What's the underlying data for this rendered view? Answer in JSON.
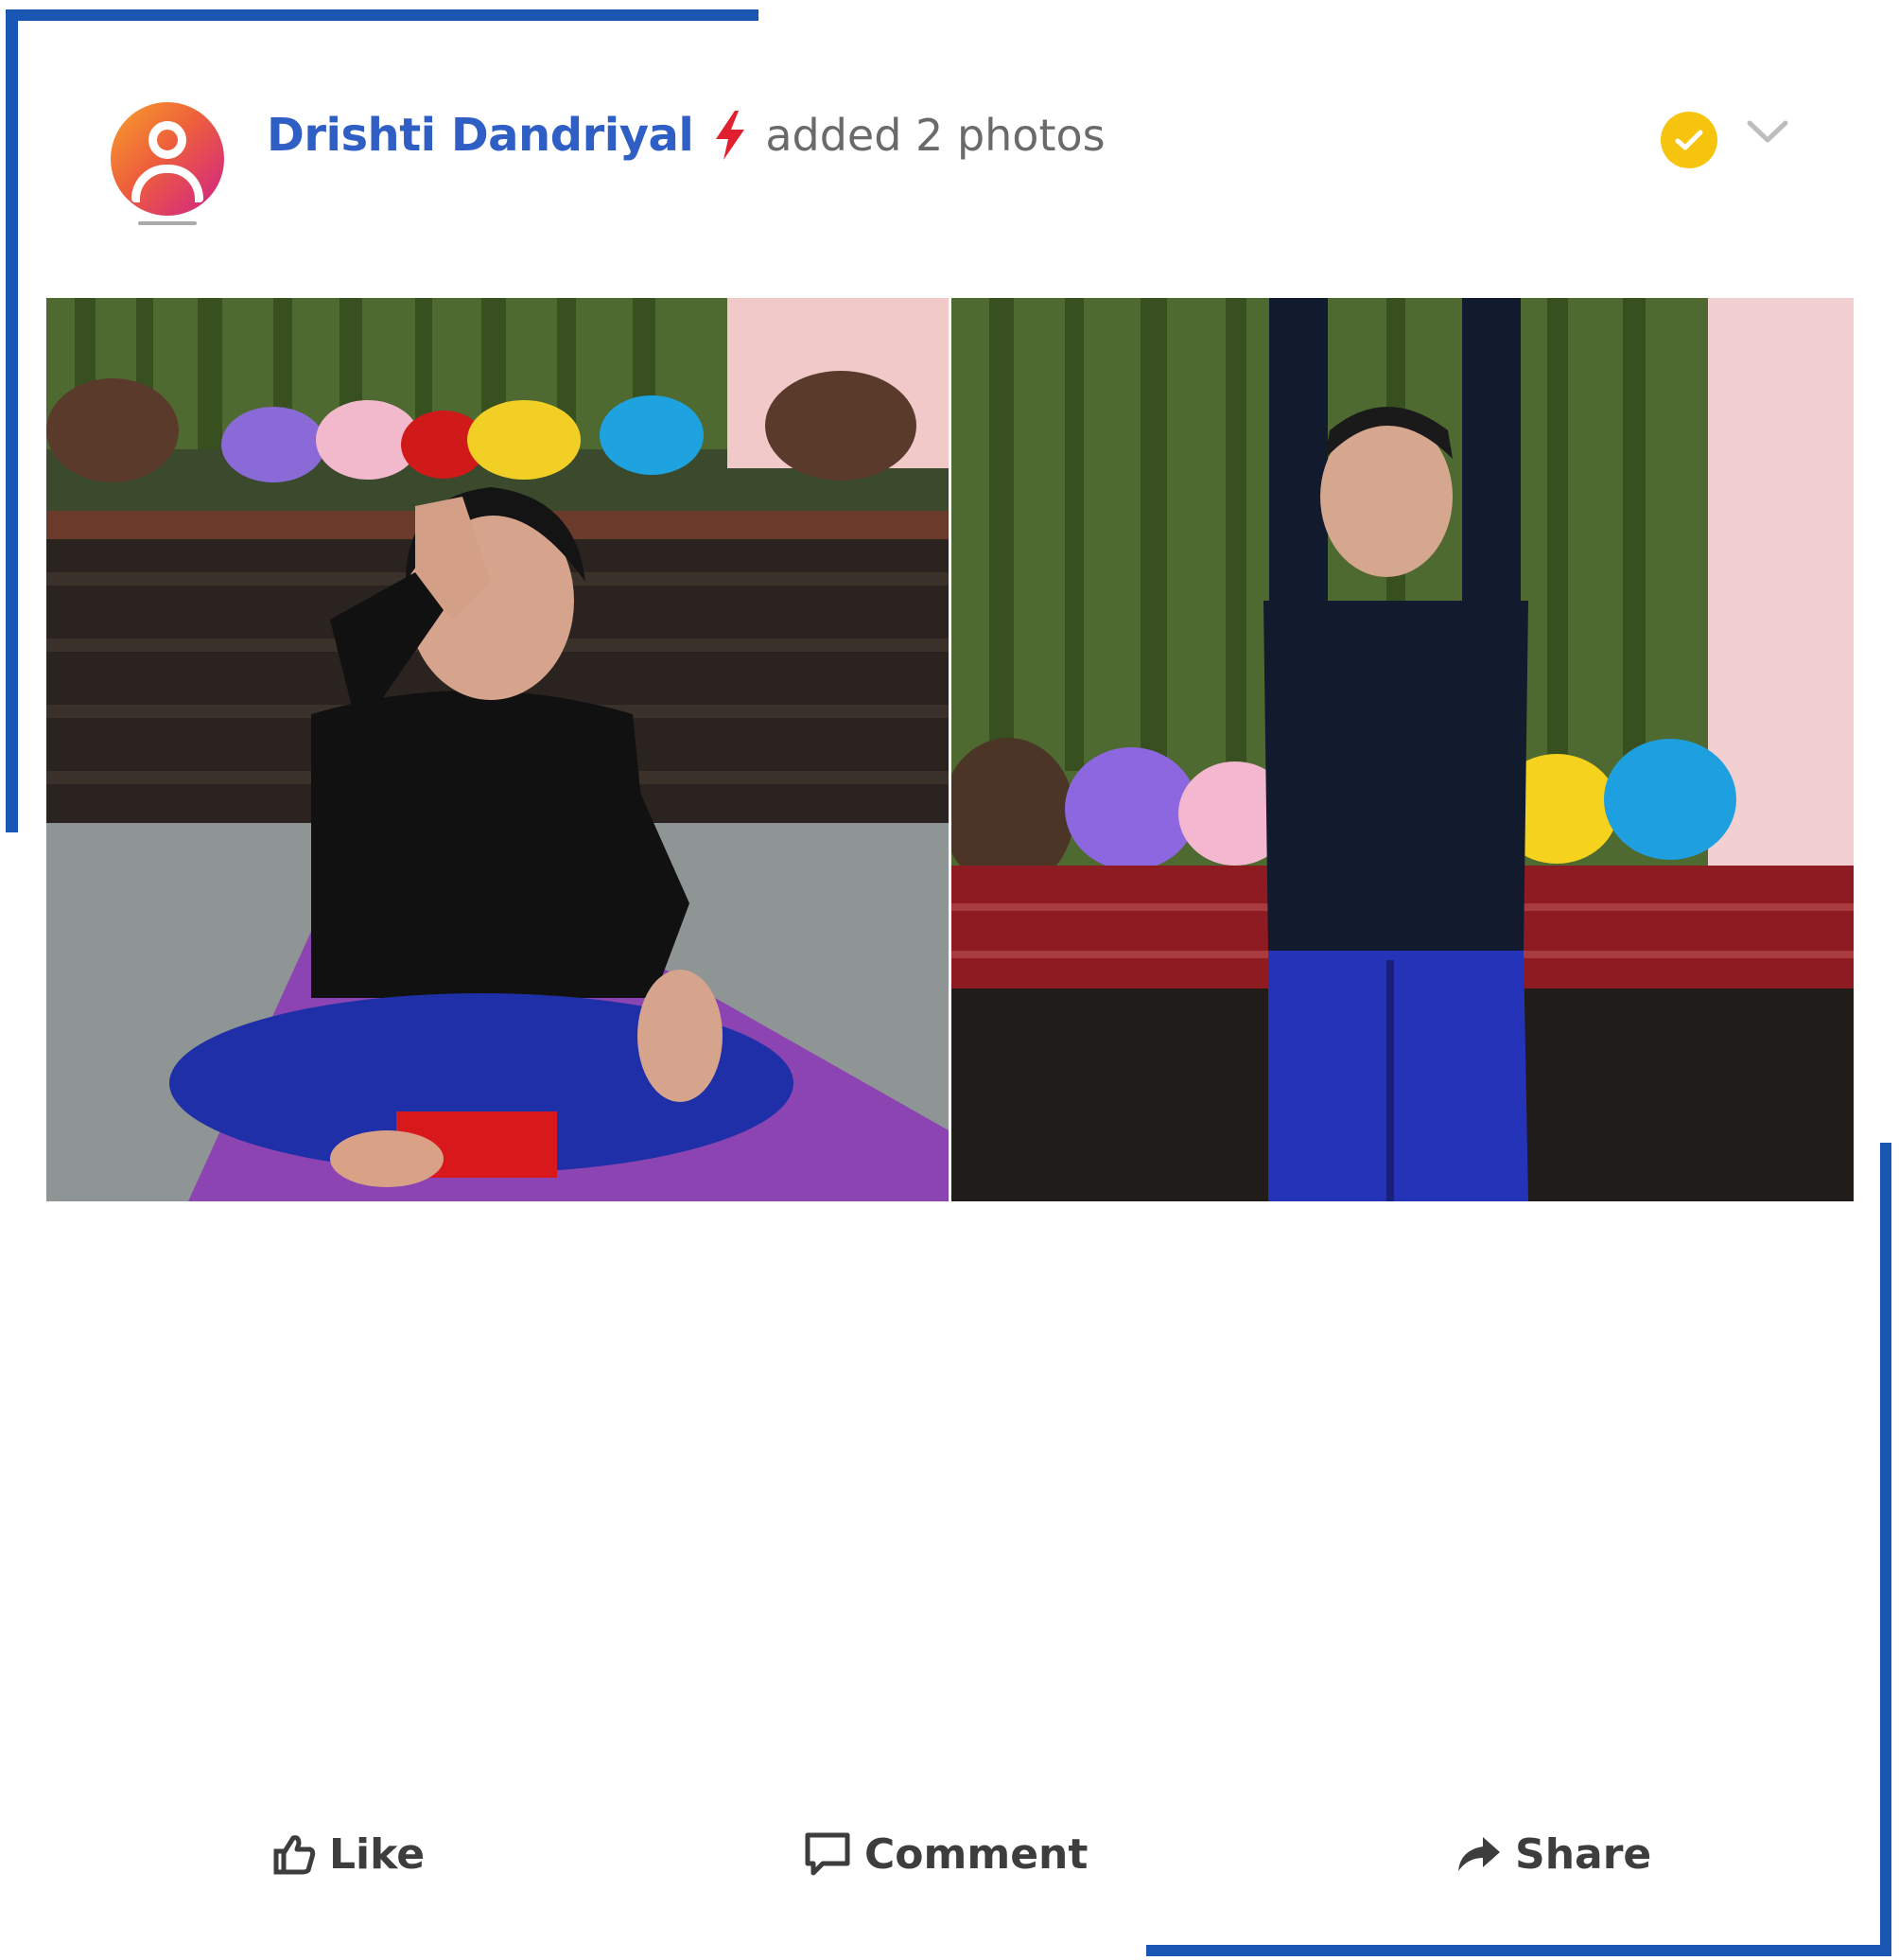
{
  "post": {
    "author_name": "Drishti Dandriyal",
    "action_text": "added 2 photos",
    "photos": [
      {
        "icon": "photo-seated-yoga-pose"
      },
      {
        "icon": "photo-standing-arms-raised-pose"
      }
    ]
  },
  "actions": {
    "like_label": "Like",
    "comment_label": "Comment",
    "share_label": "Share"
  },
  "colors": {
    "frame": "#1a56b3",
    "author": "#2f5fc4",
    "verified_badge": "#f6c40f",
    "bolt": "#e0202e"
  }
}
